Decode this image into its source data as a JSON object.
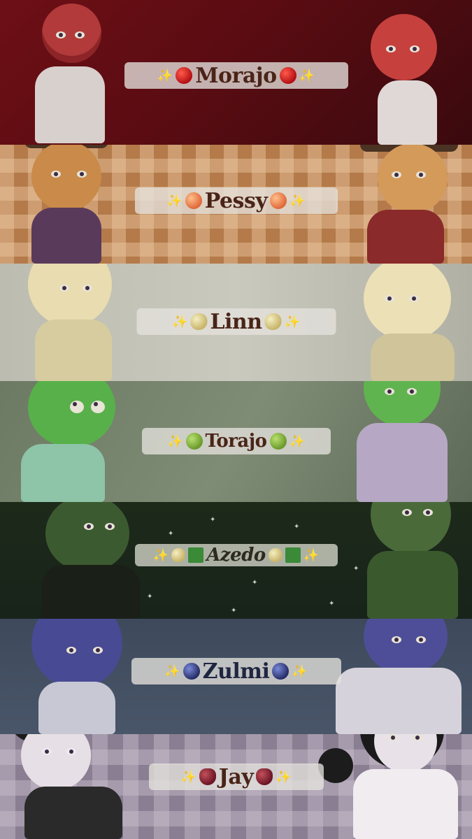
{
  "bands": [
    {
      "name": "Morajo",
      "icon": "apple-icon"
    },
    {
      "name": "Pessy",
      "icon": "peach-icon"
    },
    {
      "name": "Linn",
      "icon": "lemon-icon"
    },
    {
      "name": "Torajo",
      "icon": "green-apple-icon"
    },
    {
      "name": "Azedo",
      "icon": "lemon-icon"
    },
    {
      "name": "Zulmi",
      "icon": "blueberry-icon"
    },
    {
      "name": "Jay",
      "icon": "grapes-icon"
    }
  ],
  "colors": {
    "morajo": "#6e0f16",
    "pessy": "#b47a4a",
    "linn": "#c9c9bd",
    "torajo": "#7f8c75",
    "azedo": "#1d2a1a",
    "zulmi": "#495568",
    "jay": "#8a7e92",
    "label_bg": "#e4e2dc",
    "label_text": "#4a2418"
  }
}
